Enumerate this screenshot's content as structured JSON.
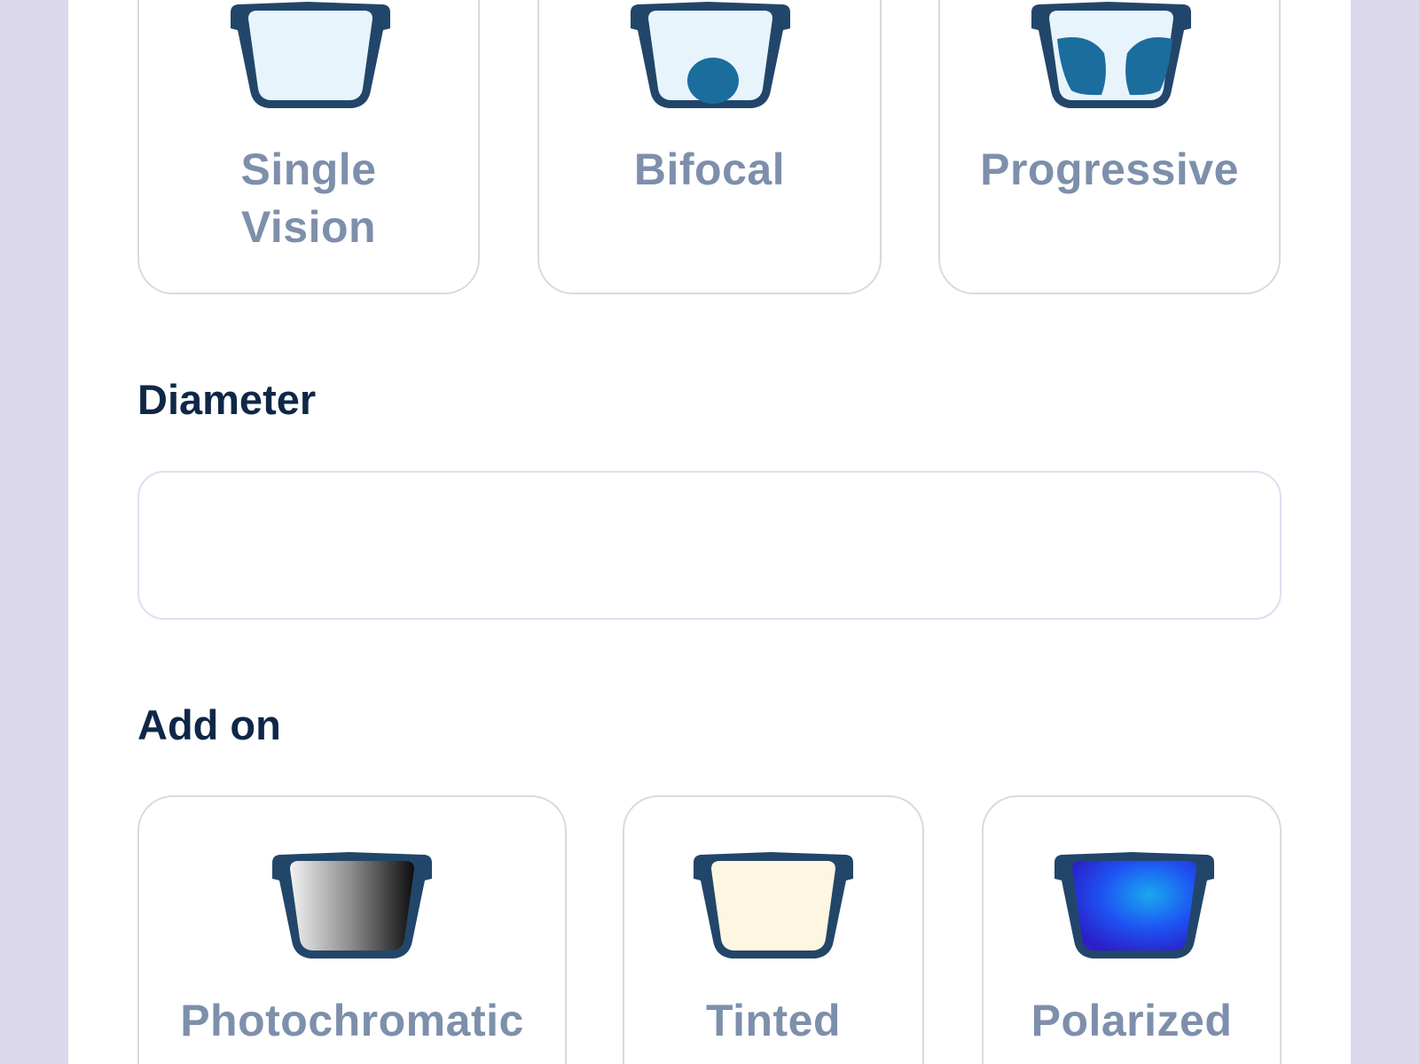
{
  "lens_types": [
    {
      "label_line1": "Single",
      "label_line2": "Vision",
      "icon": "single-vision-glasses-icon"
    },
    {
      "label_line1": "Bifocal",
      "label_line2": "",
      "icon": "bifocal-glasses-icon"
    },
    {
      "label_line1": "Progressive",
      "label_line2": "",
      "icon": "progressive-glasses-icon"
    }
  ],
  "diameter": {
    "label": "Diameter",
    "value": "",
    "placeholder": ""
  },
  "add_on": {
    "label": "Add on",
    "options": [
      {
        "label": "Photochromatic",
        "icon": "photochromatic-glasses-icon"
      },
      {
        "label": "Tinted",
        "icon": "tinted-glasses-icon"
      },
      {
        "label": "Polarized",
        "icon": "polarized-glasses-icon"
      }
    ]
  },
  "colors": {
    "page_background": "#dcd8ec",
    "panel": "#ffffff",
    "frame": "#22466a",
    "clear_lens": "#e8f4fc",
    "segment_accent": "#1b6d9e",
    "tint_lens": "#fdf6e0",
    "polarized_blue": "#1f3ef0",
    "card_label": "#7d8fab",
    "section_heading": "#0f2747"
  }
}
